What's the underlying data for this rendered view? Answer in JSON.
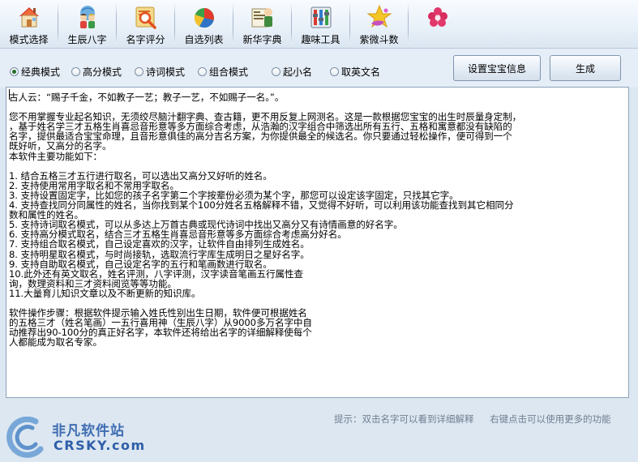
{
  "toolbar": {
    "items": [
      {
        "label": "模式选择",
        "icon": "house-icon"
      },
      {
        "label": "生辰八字",
        "icon": "kids-icon"
      },
      {
        "label": "名字评分",
        "icon": "magnifier-icon"
      },
      {
        "label": "自选列表",
        "icon": "pie-chart-icon"
      },
      {
        "label": "新华字典",
        "icon": "dictionary-icon"
      },
      {
        "label": "趣味工具",
        "icon": "toolbox-icon"
      },
      {
        "label": "紫微斗数",
        "icon": "star-icon"
      },
      {
        "label": "",
        "icon": "flower-icon"
      }
    ]
  },
  "options": {
    "radios": [
      {
        "label": "经典模式",
        "checked": true
      },
      {
        "label": "高分模式",
        "checked": false
      },
      {
        "label": "诗词模式",
        "checked": false
      },
      {
        "label": "组合模式",
        "checked": false
      },
      {
        "label": "起小名",
        "checked": false
      },
      {
        "label": "取英文名",
        "checked": false
      }
    ],
    "set_info_button": "设置宝宝信息",
    "generate_button": "生成"
  },
  "content": {
    "lines": [
      "古人云：“赐子千金，不如教子一艺；教子一艺，不如赐子一名。”。",
      "",
      "您不用掌握专业起名知识，无须绞尽脑汁翻字典、查古籍，更不用反复上网测名。这是一款根据您宝宝的出生时辰量身定制，",
      "，基于姓名学三才五格生肖喜忌音形意等多方面综合考虑，从浩瀚的汉字组合中筛选出所有五行、五格和寓意都没有缺陷的",
      "名字，提供最适合宝宝命理，且音形意俱佳的高分吉名方案，为你提供最全的候选名。你只要通过轻松操作，便可得到一个",
      "既好听，又高分的名字。",
      "本软件主要功能如下：",
      "",
      "1. 结合五格三才五行进行取名，可以选出又高分又好听的姓名。",
      "2. 支持使用常用字取名和不常用字取名。",
      "3. 支持设置固定字，比如您的孩子名字第二个字按辈份必须为某个字，那您可以设定该字固定，只找其它字。",
      "4. 支持查找同分同属性的姓名，当你找到某个100分姓名五格解释不错，又觉得不好听，可以利用该功能查找到其它相同分",
      "数和属性的姓名。",
      "5. 支持诗词取名模式，可以从多达上万首古典或现代诗词中找出又高分又有诗情画意的好名字。",
      "6. 支持高分模式取名，结合三才五格生肖喜忌音形意等多方面综合考虑高分好名。",
      "7. 支持组合取名模式，自己设定喜欢的汉字，让软件自由排列生成姓名。",
      "8. 支持明星取名模式，与时尚接轨，选取流行字库生成明日之星好名字。",
      "9. 支持自助取名模式，自己设定名字的五行和笔画数进行取名。",
      "10.此外还有英文取名，姓名评测，八字评测，汉字读音笔画五行属性查",
      "询，数理资料和三才资料阅览等等功能。",
      "11.大量育儿知识文章以及不断更新的知识库。",
      "",
      "软件操作步骤：根据软件提示输入姓氏性别出生日期，软件便可根据姓名",
      "的五格三才（姓名笔画）一五行喜用神（生辰八字）从9000多万名字中自",
      "动推荐出90-100分的真正好名字，本软件还将给出名字的详细解释使每个",
      "人都能成为取名专家。"
    ]
  },
  "hint": {
    "left": "提示：双击名字可以看到详细解释",
    "right": "右键点击可以使用更多的功能"
  },
  "watermark": {
    "brand": "非凡软件站",
    "sub": "CRSKY.com"
  },
  "colors": {
    "background": "#dde7f1",
    "toolbar_top": "#f8fbff",
    "text_area": "#ffffff",
    "hint_text": "#6f7f92",
    "watermark_blue": "#3f6db2"
  }
}
